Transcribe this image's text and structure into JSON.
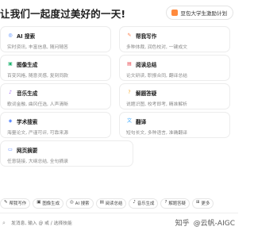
{
  "header": {
    "title": "让我们一起度过美好的一天!",
    "plan_button": "豆包大学生激励计划"
  },
  "cards": [
    {
      "name": "AI 搜索",
      "desc": "实时资讯, 丰富信息, 随问随答",
      "icon": "search-icon",
      "color": "#3b7cff",
      "glyph": "◎"
    },
    {
      "name": "帮我写作",
      "desc": "多种体裁, 润色校对, 一键成文",
      "icon": "pen-icon",
      "color": "#ff7a45",
      "glyph": "✎"
    },
    {
      "name": "图像生成",
      "desc": "百变风格, 随意灵感, 复刻同款",
      "icon": "image-icon",
      "color": "#22b573",
      "glyph": "▣"
    },
    {
      "name": "阅读总结",
      "desc": "论文研读, 职报合同, 翻译总结",
      "icon": "book-icon",
      "color": "#e8454d",
      "glyph": "▤"
    },
    {
      "name": "音乐生成",
      "desc": "歌词金融, 曲风任选, 人声清晰",
      "icon": "music-icon",
      "color": "#9b59f5",
      "glyph": "♪"
    },
    {
      "name": "解题答疑",
      "desc": "说题识图, 校考即考, 精准解析",
      "icon": "question-icon",
      "color": "#f5a623",
      "glyph": "?"
    },
    {
      "name": "学术搜索",
      "desc": "海量论文, 严谨可评, 可靠来源",
      "icon": "academic-icon",
      "color": "#2f6bff",
      "glyph": "◈"
    },
    {
      "name": "翻译",
      "desc": "短句长文, 多种语言, 准确翻译",
      "icon": "translate-icon",
      "color": "#3aa8ff",
      "glyph": "文"
    },
    {
      "name": "网页摘要",
      "desc": "任意链接, 大纲总结, 全句摘录",
      "icon": "webpage-icon",
      "color": "#4a7dff",
      "glyph": "▭"
    }
  ],
  "toolbar": [
    {
      "label": "帮我写作",
      "icon": "pen-icon",
      "glyph": "✎"
    },
    {
      "label": "图像生成",
      "icon": "image-icon",
      "glyph": "▣"
    },
    {
      "label": "AI 搜索",
      "icon": "search-icon",
      "glyph": "◎"
    },
    {
      "label": "阅读总结",
      "icon": "book-icon",
      "glyph": "▤"
    },
    {
      "label": "音乐生成",
      "icon": "music-icon",
      "glyph": "♪"
    },
    {
      "label": "解题答疑",
      "icon": "question-icon",
      "glyph": "?"
    },
    {
      "label": "更多",
      "icon": "grid-icon",
      "glyph": "⊞"
    }
  ],
  "input": {
    "placeholder": "发消息, 输入 @ 或 / 选择技能"
  },
  "watermark": {
    "site": "知乎",
    "author": "@云帆-AIGC"
  }
}
